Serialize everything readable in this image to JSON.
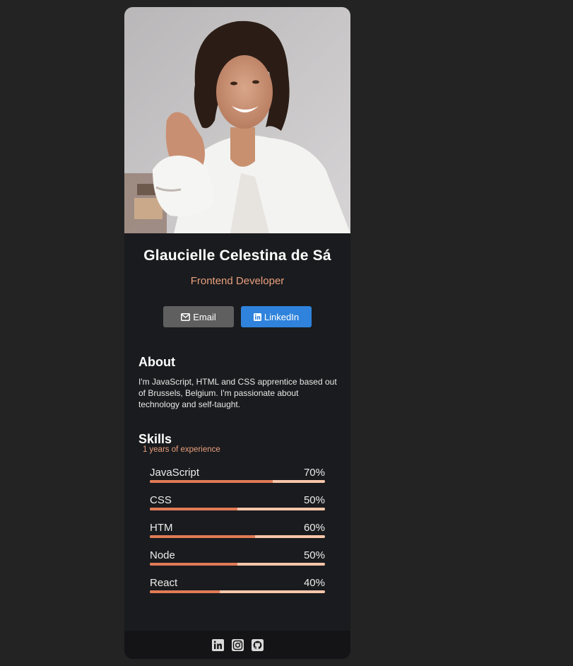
{
  "profile": {
    "name": "Glaucielle Celestina de Sá",
    "role": "Frontend Developer"
  },
  "buttons": {
    "email_label": "Email",
    "email_icon": "envelope-icon",
    "linkedin_label": "LinkedIn",
    "linkedin_icon": "linkedin-icon"
  },
  "about": {
    "title": "About",
    "text": "I'm JavaScript, HTML and CSS apprentice based out of Brussels, Belgium. I'm passionate about technology and self-taught."
  },
  "skills": {
    "title": "Skills",
    "experience_years": "1",
    "experience_text": "years of experience",
    "items": [
      {
        "name": "JavaScript",
        "percent": 70,
        "percent_label": "70%"
      },
      {
        "name": "CSS",
        "percent": 50,
        "percent_label": "50%"
      },
      {
        "name": "HTM",
        "percent": 60,
        "percent_label": "60%"
      },
      {
        "name": "Node",
        "percent": 50,
        "percent_label": "50%"
      },
      {
        "name": "React",
        "percent": 40,
        "percent_label": "40%"
      }
    ]
  },
  "footer": {
    "icons": [
      "linkedin-icon",
      "instagram-icon",
      "github-icon"
    ]
  },
  "colors": {
    "background": "#232323",
    "card": "#1a1b1e",
    "accent": "#e9a07e",
    "bar_fill": "#e17b56",
    "bar_track": "#f8c6aa",
    "email_button": "#5f5f5f",
    "linkedin_button": "#2f83dc",
    "footer": "#141416"
  }
}
